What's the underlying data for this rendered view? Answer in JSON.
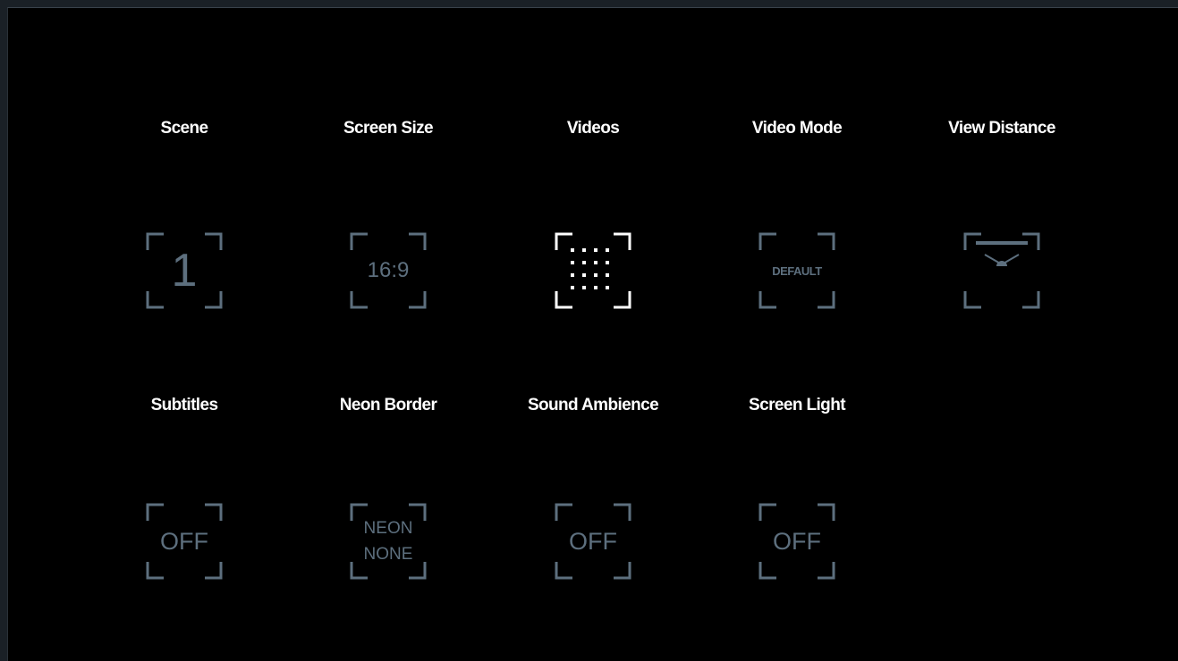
{
  "colors": {
    "background": "#000000",
    "label": "#ffffff",
    "inactive": "#5d6f7e",
    "active": "#ffffff"
  },
  "settings": [
    {
      "label": "Scene",
      "value": "1",
      "icon": "number"
    },
    {
      "label": "Screen Size",
      "value": "16:9",
      "icon": "ratio"
    },
    {
      "label": "Videos",
      "value": "",
      "icon": "grid-dots-icon",
      "active": true
    },
    {
      "label": "Video Mode",
      "value": "DEFAULT",
      "icon": "text"
    },
    {
      "label": "View Distance",
      "value": "",
      "icon": "view-distance-icon"
    },
    {
      "label": "Subtitles",
      "value": "OFF",
      "icon": "text"
    },
    {
      "label": "Neon Border",
      "value": "NEON\nNONE",
      "icon": "text"
    },
    {
      "label": "Sound Ambience",
      "value": "OFF",
      "icon": "text"
    },
    {
      "label": "Screen Light",
      "value": "OFF",
      "icon": "text"
    }
  ]
}
